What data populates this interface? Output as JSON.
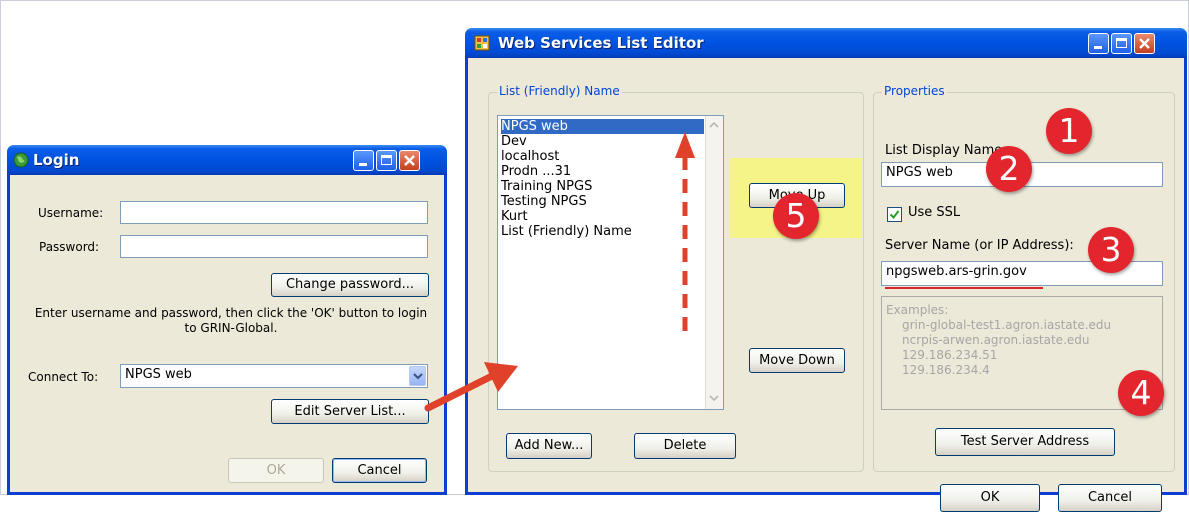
{
  "login": {
    "title": "Login",
    "username_label": "Username:",
    "password_label": "Password:",
    "username_value": "",
    "password_value": "",
    "change_password_label": "Change password...",
    "instructions": "Enter username and password, then click the 'OK' button to login to GRIN-Global.",
    "connect_to_label": "Connect To:",
    "connect_to_value": "NPGS web",
    "edit_server_list_label": "Edit Server List...",
    "ok_label": "OK",
    "cancel_label": "Cancel"
  },
  "editor": {
    "title": "Web Services List Editor",
    "list_group_title": "List (Friendly) Name",
    "list_items": [
      "NPGS web",
      "Dev",
      "localhost",
      "Prodn ...31",
      "Training NPGS",
      "Testing NPGS",
      "Kurt",
      "List (Friendly) Name"
    ],
    "selected_item": "NPGS web",
    "move_up_label": "Move Up",
    "move_down_label": "Move Down",
    "add_new_label": "Add New...",
    "delete_label": "Delete",
    "properties_group_title": "Properties",
    "display_name_label": "List Display Name:",
    "display_name_value": "NPGS web",
    "use_ssl_label": "Use SSL",
    "use_ssl_checked": true,
    "server_name_label": "Server Name (or IP Address):",
    "server_name_value": "npgsweb.ars-grin.gov",
    "examples": [
      "Examples:",
      "grin-global-test1.agron.iastate.edu",
      "ncrpis-arwen.agron.iastate.edu",
      "129.186.234.51",
      "129.186.234.4"
    ],
    "test_server_label": "Test Server Address",
    "ok_label": "OK",
    "cancel_label": "Cancel"
  },
  "annotations": {
    "markers": [
      "1",
      "2",
      "3",
      "4",
      "5"
    ],
    "marker_color": "#e3262e",
    "arrow_color": "#e0412a",
    "highlight_color": "#f6f67a"
  }
}
